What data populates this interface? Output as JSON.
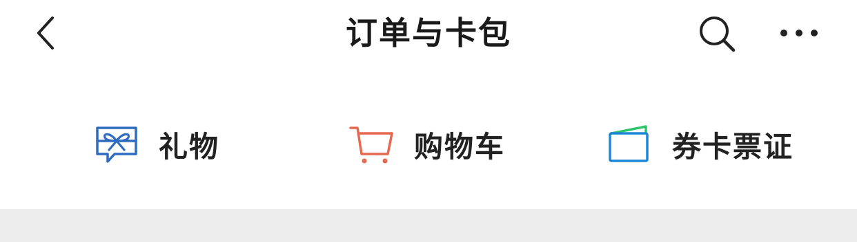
{
  "header": {
    "title": "订单与卡包"
  },
  "icons": {
    "back": "chevron-left-icon",
    "search": "search-icon",
    "more": "more-dots-icon"
  },
  "quick_links": [
    {
      "label": "礼物",
      "icon": "gift-message-icon",
      "color": "#2f6bc0"
    },
    {
      "label": "购物车",
      "icon": "shopping-cart-icon",
      "color": "#e8674f"
    },
    {
      "label": "券卡票证",
      "icon": "card-wallet-icon",
      "color": "#1f86d6"
    }
  ]
}
